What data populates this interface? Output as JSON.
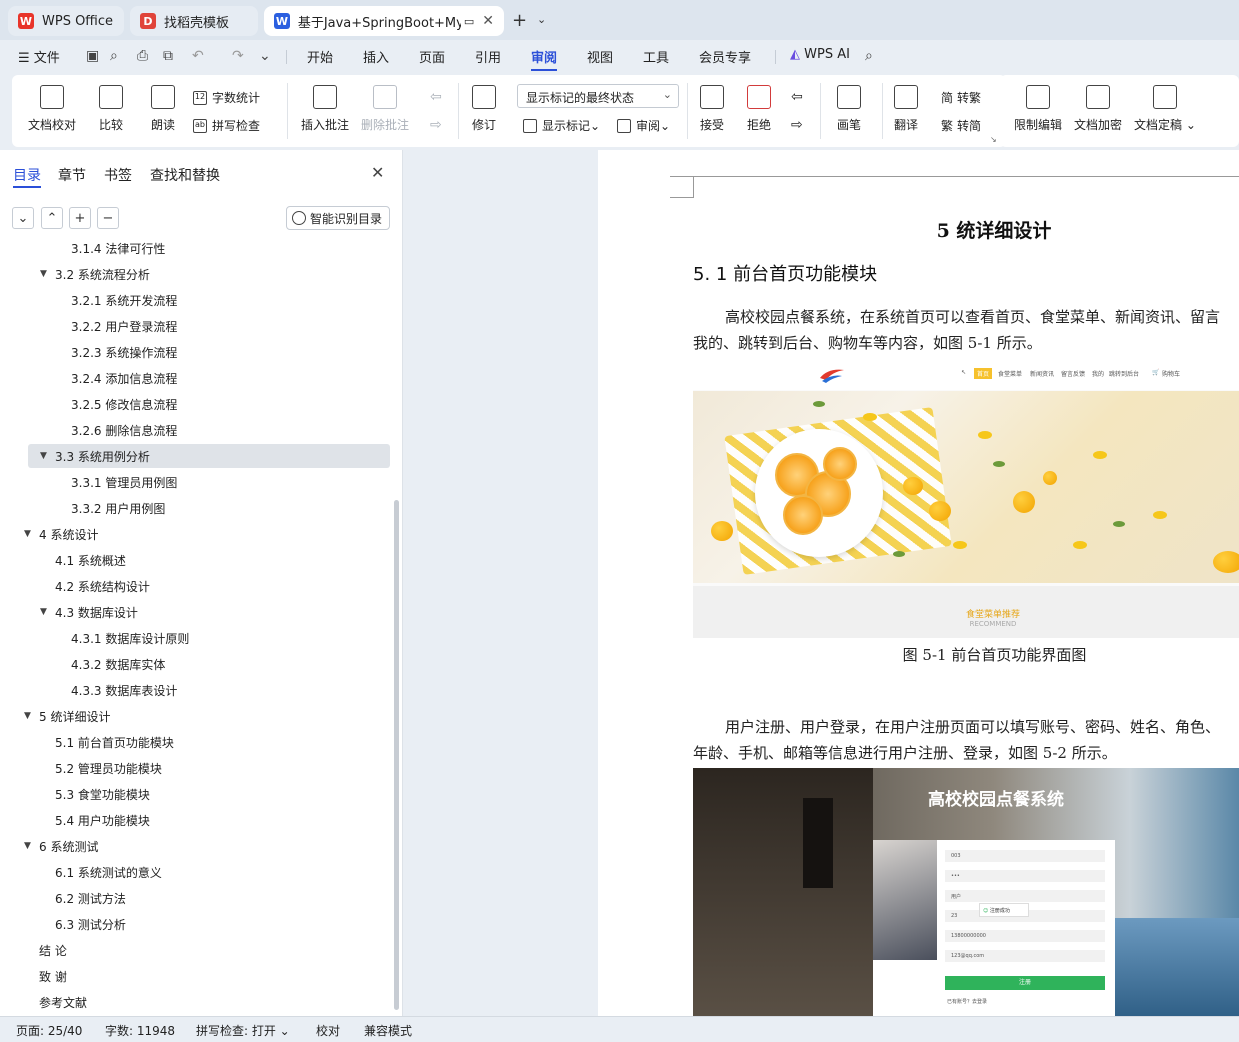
{
  "tabs": [
    {
      "label": "WPS Office",
      "icon": "wps-logo-icon"
    },
    {
      "label": "找稻壳模板",
      "icon": "docer-logo-icon"
    },
    {
      "label": "基于Java+SpringBoot+MyS",
      "icon": "word-doc-icon"
    }
  ],
  "menu": {
    "file": "文件",
    "items": [
      "开始",
      "插入",
      "页面",
      "引用",
      "审阅",
      "视图",
      "工具",
      "会员专享"
    ],
    "active": "审阅",
    "wps_ai": "WPS AI"
  },
  "ribbon": {
    "doc_proof": "文档校对",
    "compare": "比较",
    "read_aloud": "朗读",
    "word_count": "字数统计",
    "spell_check": "拼写检查",
    "insert_comment": "插入批注",
    "delete_comment": "删除批注",
    "track_changes": "修订",
    "markup_state": "显示标记的最终状态",
    "show_markup": "显示标记",
    "review": "审阅",
    "accept": "接受",
    "reject": "拒绝",
    "pen": "画笔",
    "translate": "翻译",
    "to_traditional": "转繁",
    "to_simplified": "转简",
    "restrict_edit": "限制编辑",
    "encrypt": "文档加密",
    "finalize": "文档定稿",
    "trad_glyph": "简",
    "simp_glyph": "繁"
  },
  "sidebar": {
    "tabs": [
      "目录",
      "章节",
      "书签",
      "查找和替换"
    ],
    "active_tab": "目录",
    "smart_toc": "智能识别目录",
    "toc": [
      {
        "text": "3.1.4  法律可行性",
        "level": 3,
        "arrow": ""
      },
      {
        "text": "3.2 系统流程分析",
        "level": 2,
        "arrow": "▼"
      },
      {
        "text": "3.2.1 系统开发流程",
        "level": 3,
        "arrow": ""
      },
      {
        "text": "3.2.2  用户登录流程",
        "level": 3,
        "arrow": ""
      },
      {
        "text": "3.2.3  系统操作流程",
        "level": 3,
        "arrow": ""
      },
      {
        "text": "3.2.4  添加信息流程",
        "level": 3,
        "arrow": ""
      },
      {
        "text": "3.2.5  修改信息流程",
        "level": 3,
        "arrow": ""
      },
      {
        "text": "3.2.6  删除信息流程",
        "level": 3,
        "arrow": ""
      },
      {
        "text": "3.3 系统用例分析",
        "level": 2,
        "arrow": "▼",
        "selected": true
      },
      {
        "text": "3.3.1 管理员用例图",
        "level": 3,
        "arrow": ""
      },
      {
        "text": "3.3.2 用户用例图",
        "level": 3,
        "arrow": ""
      },
      {
        "text": "4  系统设计",
        "level": 1,
        "arrow": "▼"
      },
      {
        "text": "4.1  系统概述",
        "level": 2,
        "arrow": ""
      },
      {
        "text": "4.2  系统结构设计",
        "level": 2,
        "arrow": ""
      },
      {
        "text": "4.3 数据库设计",
        "level": 2,
        "arrow": "▼"
      },
      {
        "text": "4.3.1  数据库设计原则",
        "level": 3,
        "arrow": ""
      },
      {
        "text": "4.3.2  数据库实体",
        "level": 3,
        "arrow": ""
      },
      {
        "text": "4.3.3  数据库表设计",
        "level": 3,
        "arrow": ""
      },
      {
        "text": "5 统详细设计",
        "level": 1,
        "arrow": "▼"
      },
      {
        "text": "5.1 前台首页功能模块",
        "level": 2,
        "arrow": ""
      },
      {
        "text": "5.2 管理员功能模块",
        "level": 2,
        "arrow": ""
      },
      {
        "text": "5.3 食堂功能模块",
        "level": 2,
        "arrow": ""
      },
      {
        "text": "5.4 用户功能模块",
        "level": 2,
        "arrow": ""
      },
      {
        "text": "6 系统测试",
        "level": 1,
        "arrow": "▼"
      },
      {
        "text": "6.1 系统测试的意义",
        "level": 2,
        "arrow": ""
      },
      {
        "text": "6.2  测试方法",
        "level": 2,
        "arrow": ""
      },
      {
        "text": "6.3 测试分析",
        "level": 2,
        "arrow": ""
      },
      {
        "text": "结      论",
        "level": 1,
        "arrow": ""
      },
      {
        "text": "致      谢",
        "level": 1,
        "arrow": ""
      },
      {
        "text": "参考文献",
        "level": 1,
        "arrow": ""
      }
    ]
  },
  "document": {
    "chapter_title": "5 统详细设计",
    "section_title": "5. 1 前台首页功能模块",
    "para1_line1": "高校校园点餐系统，在系统首页可以查看首页、食堂菜单、新闻资讯、留言",
    "para1_line2": "我的、跳转到后台、购物车等内容，如图 5-1 所示。",
    "fig1_caption": "图 5-1 前台首页功能界面图",
    "para2_line1": "用户注册、用户登录，在用户注册页面可以填写账号、密码、姓名、角色、",
    "para2_line2": "年龄、手机、邮箱等信息进行用户注册、登录，如图 5-2 所示。",
    "fig1": {
      "nav": [
        "首页",
        "食堂菜单",
        "新闻资讯",
        "留言反馈",
        "我的",
        "跳转到后台",
        "购物车"
      ],
      "recommend_cn": "食堂菜单推荐",
      "recommend_en": "RECOMMEND"
    },
    "fig2": {
      "title": "高校校园点餐系统",
      "fields": [
        "003",
        "•••",
        "用户",
        "23",
        "13800000000",
        "123@qq.com"
      ],
      "toast": "注册成功",
      "submit": "注册",
      "footer": "已有账号？去登录"
    }
  },
  "status": {
    "page": "页面: 25/40",
    "words": "字数: 11948",
    "spell": "拼写检查: 打开",
    "proof": "校对",
    "compat": "兼容模式"
  },
  "colors": {
    "accent": "#2b4fd8",
    "wps_red": "#e8342a",
    "word_blue": "#2b5fe0"
  }
}
